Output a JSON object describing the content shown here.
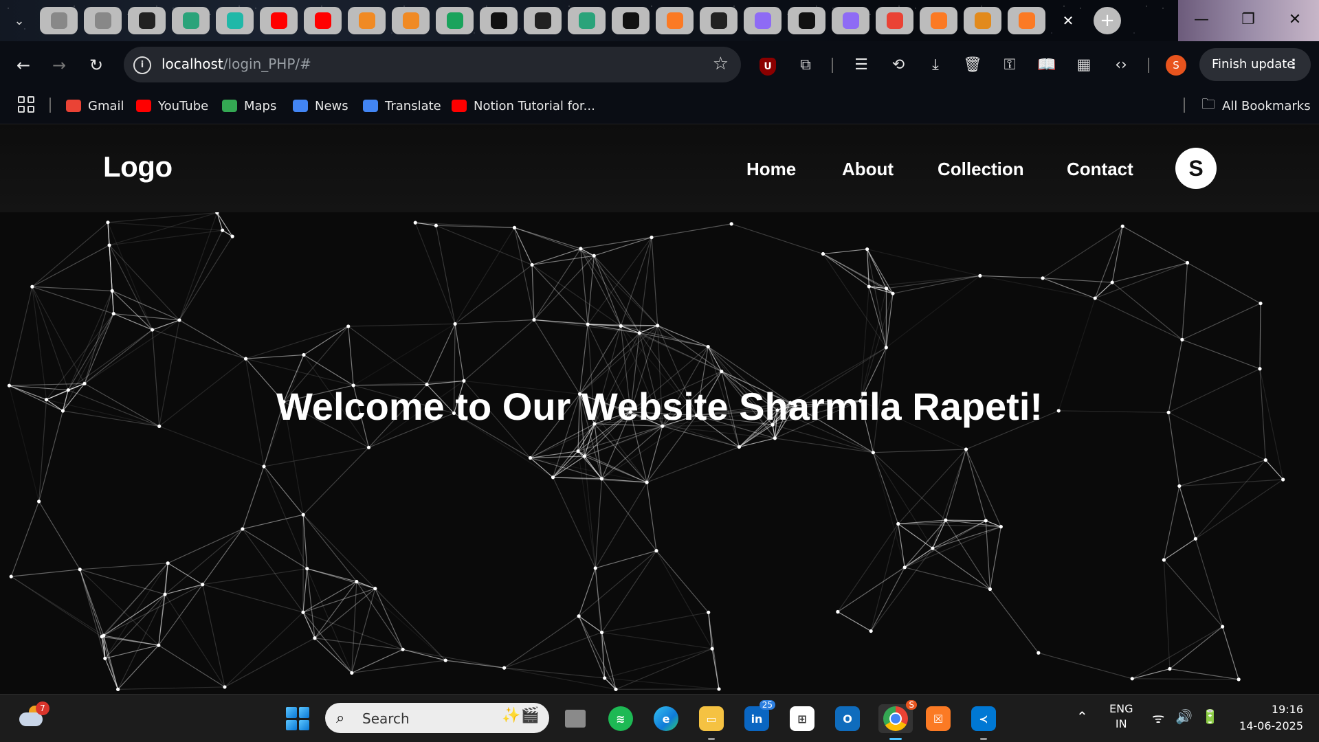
{
  "browser": {
    "tab_count": 22,
    "tab_icons": [
      "tab-icon",
      "tab-icon",
      "notion-icon",
      "chatgpt-icon",
      "perplexity-icon",
      "youtube-icon",
      "youtube-icon",
      "diamond-icon",
      "diamond-icon",
      "plus-circle-icon",
      "triangle-icon",
      "github-icon",
      "vercel-icon",
      "openai-icon",
      "xampp-icon",
      "extension-icon",
      "gemini-icon",
      "circle-icon",
      "gemini-icon",
      "gmail-icon",
      "xampp-icon",
      "pma-icon",
      "xampp-icon"
    ],
    "url_host": "localhost",
    "url_path": "/login_PHP/#",
    "profile_initial": "S",
    "finish_update_label": "Finish update",
    "bookmarks": [
      {
        "label": "Gmail",
        "icon": "gmail-icon",
        "color": "#ea4335"
      },
      {
        "label": "YouTube",
        "icon": "youtube-icon",
        "color": "#ff0000"
      },
      {
        "label": "Maps",
        "icon": "maps-icon",
        "color": "#34a853"
      },
      {
        "label": "News",
        "icon": "news-icon",
        "color": "#4285f4"
      },
      {
        "label": "Translate",
        "icon": "translate-icon",
        "color": "#4285f4"
      },
      {
        "label": "Notion Tutorial for...",
        "icon": "youtube-icon",
        "color": "#ff0000"
      }
    ],
    "all_bookmarks_label": "All Bookmarks"
  },
  "site": {
    "logo": "Logo",
    "nav": [
      "Home",
      "About",
      "Collection",
      "Contact"
    ],
    "avatar_initial": "S",
    "hero_title": "Welcome to Our Website Sharmila Rapeti!"
  },
  "taskbar": {
    "weather_badge": "7",
    "search_placeholder": "Search",
    "linkedin_badge": "25",
    "chrome_badge": "S",
    "lang_line1": "ENG",
    "lang_line2": "IN",
    "time": "19:16",
    "date": "14-06-2025"
  }
}
